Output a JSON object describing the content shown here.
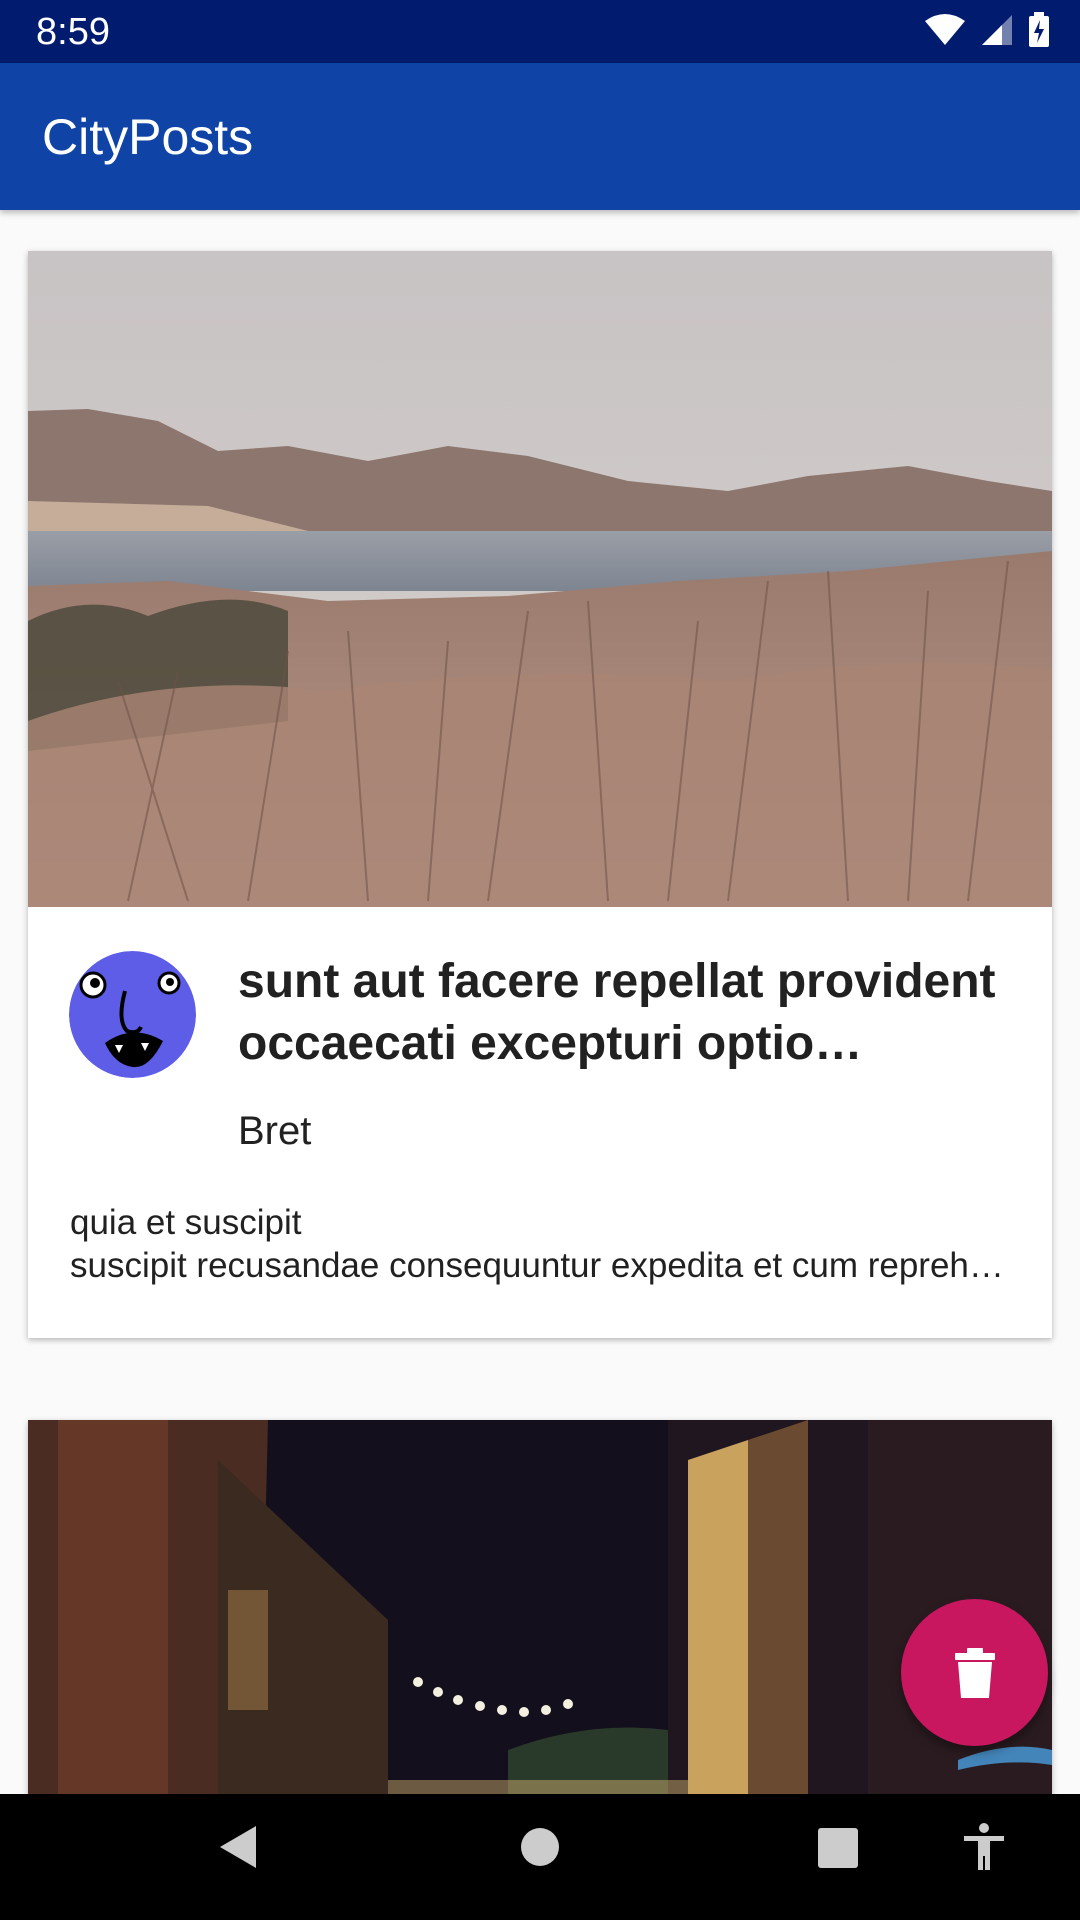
{
  "status_bar": {
    "time": "8:59",
    "icons": [
      "wifi-icon",
      "signal-icon",
      "battery-charging-icon"
    ]
  },
  "app_bar": {
    "title": "CityPosts",
    "color": "#0f44a6"
  },
  "posts": [
    {
      "title": "sunt aut facere repellat provident occaecati excepturi optio reprehenderit",
      "author": "Bret",
      "body_line_1": "quia et suscipit",
      "body_line_2": "suscipit recusandae consequuntur expedita et cum reprehenderit molestiae ut ut quas totam",
      "image": "lake-hills-landscape",
      "avatar": "blue-face-avatar"
    },
    {
      "image": "night-street-lights"
    }
  ],
  "fab": {
    "icon": "delete-icon",
    "color": "#c8175f"
  },
  "nav_bar": {
    "icons": [
      "back-icon",
      "home-icon",
      "recents-icon",
      "accessibility-icon"
    ]
  }
}
